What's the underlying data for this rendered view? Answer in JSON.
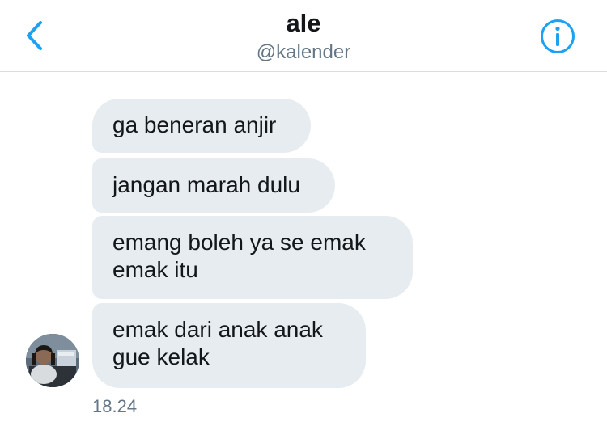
{
  "header": {
    "title": "ale",
    "handle": "@kalender"
  },
  "messages": [
    {
      "text": "ga beneran anjir"
    },
    {
      "text": "jangan marah dulu"
    },
    {
      "text": "emang boleh ya se emak\nemak itu"
    },
    {
      "text": "emak dari anak anak\ngue kelak"
    }
  ],
  "timestamp": "18.24",
  "colors": {
    "accent": "#1da1f2",
    "bubble": "#e6ecf0",
    "secondary_text": "#657786"
  },
  "icons": {
    "back": "chevron-left-icon",
    "info": "info-icon"
  }
}
